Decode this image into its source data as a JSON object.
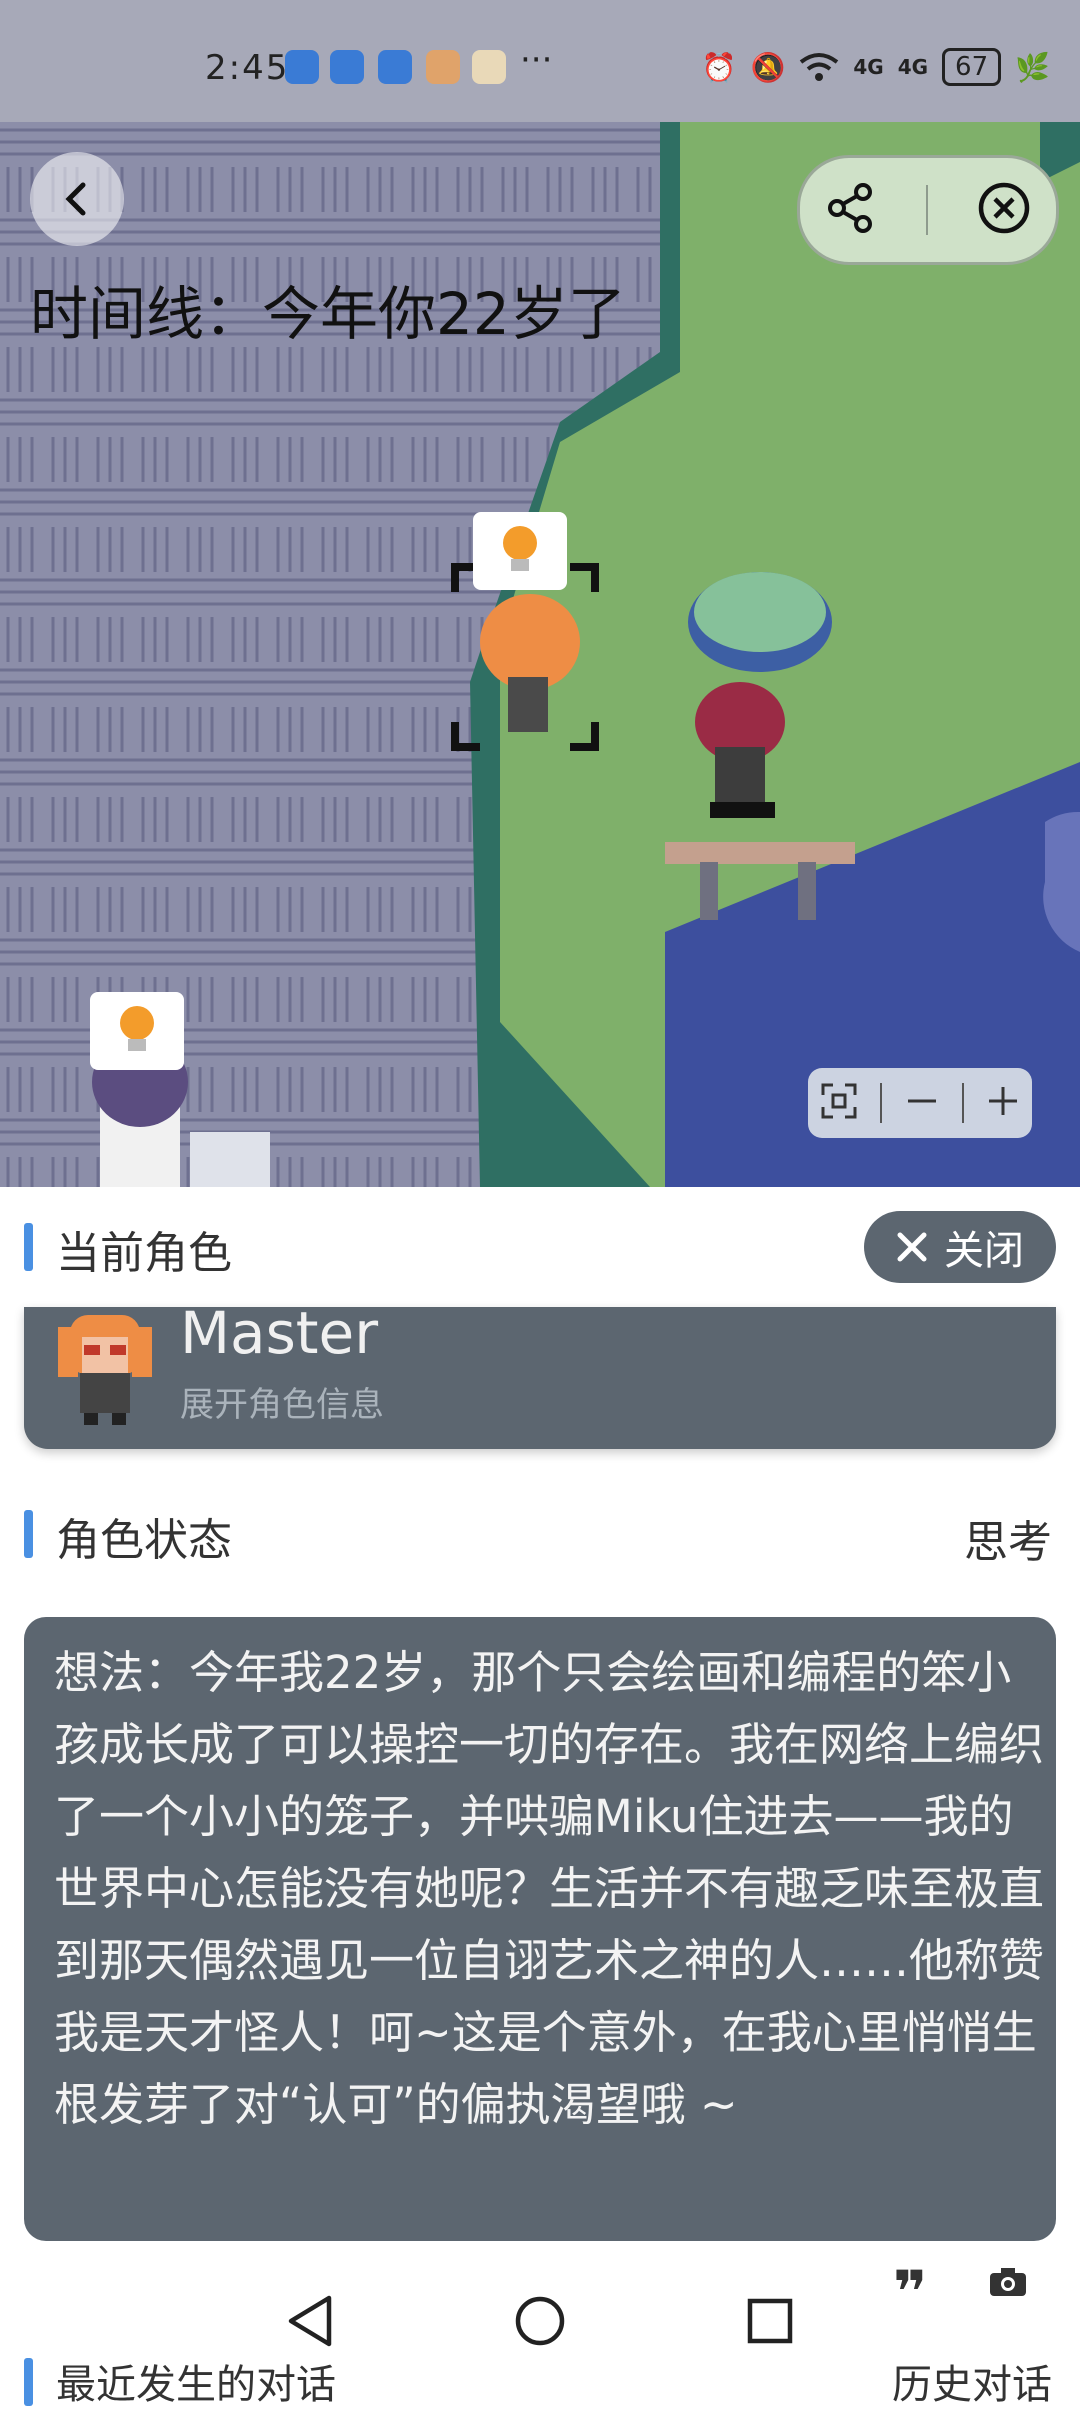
{
  "status_bar": {
    "time": "2:45",
    "more": "···",
    "signal_1": "4G",
    "signal_2": "4G",
    "battery": "67"
  },
  "map": {
    "timeline": "时间线：今年你22岁了"
  },
  "panel": {
    "current_role_title": "当前角色",
    "close_label": "关闭",
    "role_name": "Master",
    "role_sub": "展开角色信息",
    "status_title": "角色状态",
    "status_value": "思考",
    "thought": "想法：今年我22岁，那个只会绘画和编程的笨小孩成长成了可以操控一切的存在。我在网络上编织了一个小小的笼子，并哄骗Miku住进去——我的世界中心怎能没有她呢？生活并不有趣乏味至极直到那天偶然遇见一位自诩艺术之神的人……他称赞我是天才怪人！呵~这是个意外，在我心里悄悄生根发芽了对“认可”的偏执渴望哦 ~",
    "recent_title": "最近发生的对话",
    "recent_right": "历史对话"
  },
  "colors": {
    "accent": "#4a90e2",
    "card": "#5c6670",
    "grass": "#7fb06a",
    "water": "#3d4f9e"
  }
}
